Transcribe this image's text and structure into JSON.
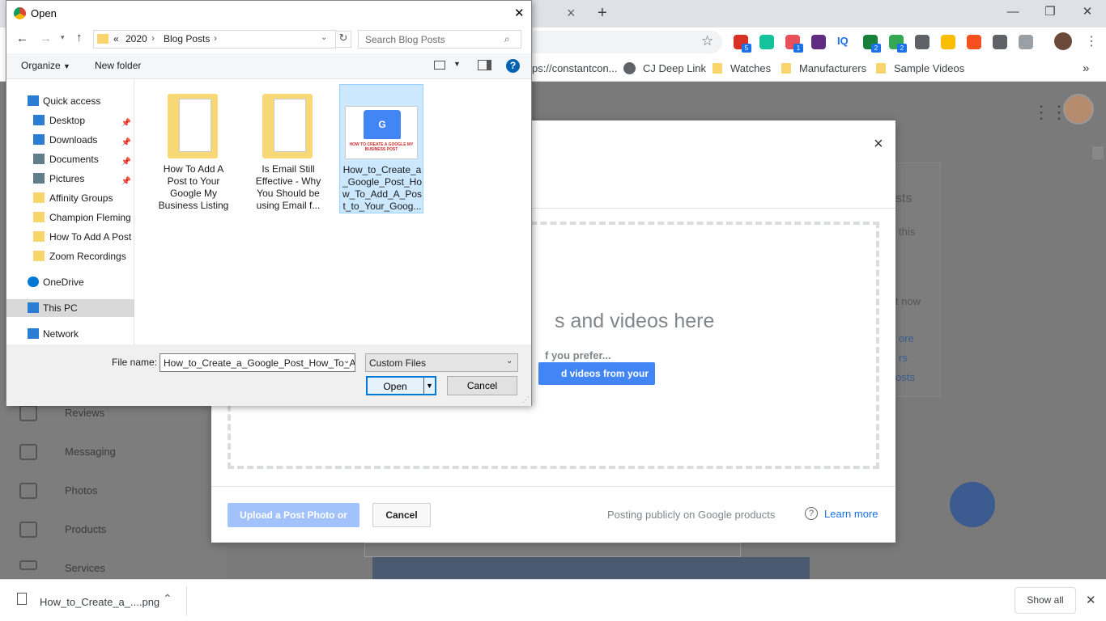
{
  "browser": {
    "tab_close": "×",
    "new_tab": "+",
    "window_controls": {
      "minimize": "—",
      "restore": "❐",
      "close": "✕"
    },
    "address_text": "",
    "extensions": [
      {
        "icon": "ext-red-icon",
        "badge": "5",
        "color": "#d93025"
      },
      {
        "icon": "grammarly-icon",
        "badge": "",
        "color": "#15c39a"
      },
      {
        "icon": "ext-share-icon",
        "badge": "1",
        "color": "#e8505b"
      },
      {
        "icon": "ext-circle-icon",
        "badge": "",
        "color": "#5f2c82"
      },
      {
        "icon": "iq-icon",
        "label": "IQ",
        "badge": "",
        "color": "#1a73e8"
      },
      {
        "icon": "ext-green-icon",
        "badge": "2",
        "color": "#188038"
      },
      {
        "icon": "ext-green2-icon",
        "badge": "2",
        "color": "#34a853"
      },
      {
        "icon": "ext-pin-icon",
        "badge": "",
        "color": "#5f6368"
      },
      {
        "icon": "chrome-ext-icon",
        "badge": "",
        "color": "#fbbc04"
      },
      {
        "icon": "ext-orange-icon",
        "badge": "",
        "color": "#f4511e"
      },
      {
        "icon": "ext-grey-icon",
        "badge": "",
        "color": "#5f6368"
      },
      {
        "icon": "shield-icon",
        "badge": "",
        "color": "#9aa0a6"
      }
    ],
    "bookmarks": [
      {
        "label": "ps://constantcon...",
        "icon": "none"
      },
      {
        "label": "CJ Deep Link",
        "icon": "globe-icon"
      },
      {
        "label": "Watches",
        "icon": "folder-icon"
      },
      {
        "label": "Manufacturers",
        "icon": "folder-icon"
      },
      {
        "label": "Sample Videos",
        "icon": "folder-icon"
      }
    ],
    "more_bookmarks": "»"
  },
  "background_page": {
    "nav": [
      "Reviews",
      "Messaging",
      "Photos",
      "Products",
      "Services"
    ],
    "side_card": [
      "sts",
      "this",
      "t now",
      "ore",
      "rs",
      "osts"
    ]
  },
  "upload_modal": {
    "close": "×",
    "drop_text": "s and videos here",
    "prefer_text": "f you prefer...",
    "select_button": "d videos from your computer",
    "upload_button": "Upload a Post Photo or Video",
    "cancel_button": "Cancel",
    "posting_text": "Posting publicly on Google products",
    "learn_more": "Learn more"
  },
  "dialog": {
    "title": "Open",
    "close": "✕",
    "breadcrumb": [
      "«",
      "2020",
      "Blog Posts"
    ],
    "search_placeholder": "Search Blog Posts",
    "organize": "Organize",
    "new_folder": "New folder",
    "help": "?",
    "tree": [
      {
        "label": "Quick access",
        "icon": "star-icon",
        "level": 0
      },
      {
        "label": "Desktop",
        "icon": "desktop-icon",
        "level": 1,
        "pinned": true
      },
      {
        "label": "Downloads",
        "icon": "download-icon",
        "level": 1,
        "pinned": true
      },
      {
        "label": "Documents",
        "icon": "documents-icon",
        "level": 1,
        "pinned": true
      },
      {
        "label": "Pictures",
        "icon": "pictures-icon",
        "level": 1,
        "pinned": true
      },
      {
        "label": "Affinity Groups",
        "icon": "folder-icon",
        "level": 1
      },
      {
        "label": "Champion Fleming",
        "icon": "folder-icon",
        "level": 1
      },
      {
        "label": "How To Add A Post",
        "icon": "folder-icon",
        "level": 1
      },
      {
        "label": "Zoom Recordings",
        "icon": "folder-icon",
        "level": 1
      },
      {
        "label": "OneDrive",
        "icon": "cloud-icon",
        "level": 0
      },
      {
        "label": "This PC",
        "icon": "pc-icon",
        "level": 0,
        "selected": true
      },
      {
        "label": "Network",
        "icon": "network-icon",
        "level": 0
      }
    ],
    "files": [
      {
        "label": "How To Add A Post to Your Google My Business Listing",
        "type": "folder"
      },
      {
        "label": "Is Email Still Effective - Why You Should be using Email f...",
        "type": "folder"
      },
      {
        "label": "How_to_Create_a_Google_Post_How_To_Add_A_Post_to_Your_Goog...",
        "type": "image",
        "selected": true,
        "thumb_text": "HOW TO CREATE A GOOGLE MY BUSINESS POST"
      }
    ],
    "file_name_label": "File name:",
    "file_name_value": "How_to_Create_a_Google_Post_How_To_A",
    "file_type": "Custom Files",
    "open_button": "Open",
    "cancel_button": "Cancel"
  },
  "download_bar": {
    "file": "How_to_Create_a_....png",
    "show_all": "Show all",
    "close": "✕"
  }
}
